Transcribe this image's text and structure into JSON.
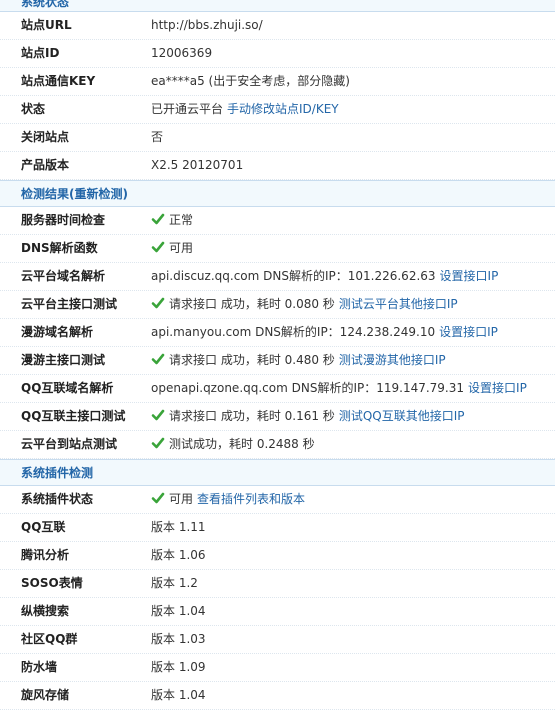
{
  "sections": [
    {
      "title": "系统状态",
      "rows": [
        {
          "label": "站点URL",
          "text": "http://bbs.zhuji.so/"
        },
        {
          "label": "站点ID",
          "text": "12006369"
        },
        {
          "label": "站点通信KEY",
          "text": "ea****a5 (出于安全考虑，部分隐藏)"
        },
        {
          "label": "状态",
          "text": "已开通云平台",
          "link": "手动修改站点ID/KEY"
        },
        {
          "label": "关闭站点",
          "text": "否"
        },
        {
          "label": "产品版本",
          "text": "X2.5 20120701"
        }
      ]
    },
    {
      "title": "检测结果(重新检测)",
      "rows": [
        {
          "label": "服务器时间检查",
          "check": true,
          "text": "正常"
        },
        {
          "label": "DNS解析函数",
          "check": true,
          "text": "可用"
        },
        {
          "label": "云平台域名解析",
          "text": "api.discuz.qq.com DNS解析的IP：101.226.62.63",
          "link": "设置接口IP"
        },
        {
          "label": "云平台主接口测试",
          "check": true,
          "text": "请求接口 成功，耗时 0.080 秒",
          "link": "测试云平台其他接口IP"
        },
        {
          "label": "漫游域名解析",
          "text": "api.manyou.com DNS解析的IP：124.238.249.10",
          "link": "设置接口IP"
        },
        {
          "label": "漫游主接口测试",
          "check": true,
          "text": "请求接口 成功，耗时 0.480 秒",
          "link": "测试漫游其他接口IP"
        },
        {
          "label": "QQ互联域名解析",
          "text": "openapi.qzone.qq.com DNS解析的IP：119.147.79.31",
          "link": "设置接口IP"
        },
        {
          "label": "QQ互联主接口测试",
          "check": true,
          "text": "请求接口 成功，耗时 0.161 秒",
          "link": "测试QQ互联其他接口IP"
        },
        {
          "label": "云平台到站点测试",
          "check": true,
          "text": "测试成功，耗时 0.2488 秒"
        }
      ]
    },
    {
      "title": "系统插件检测",
      "rows": [
        {
          "label": "系统插件状态",
          "check": true,
          "text": "可用",
          "link": "查看插件列表和版本"
        },
        {
          "label": "QQ互联",
          "text": "版本 1.11"
        },
        {
          "label": "腾讯分析",
          "text": "版本 1.06"
        },
        {
          "label": "SOSO表情",
          "text": "版本 1.2"
        },
        {
          "label": "纵横搜索",
          "text": "版本 1.04"
        },
        {
          "label": "社区QQ群",
          "text": "版本 1.03"
        },
        {
          "label": "防水墙",
          "text": "版本 1.09"
        },
        {
          "label": "旋风存储",
          "text": "版本 1.04"
        }
      ]
    }
  ],
  "colors": {
    "accent": "#2366a8",
    "check": "#3aa43a",
    "header_bg": "#f2f9fd"
  },
  "icons": {
    "check": "check-icon"
  }
}
